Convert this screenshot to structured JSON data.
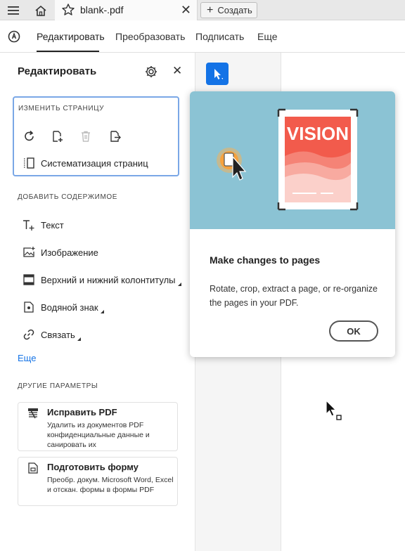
{
  "tabbar": {
    "tab_title": "blank-.pdf",
    "create_label": "Создать"
  },
  "topnav": {
    "items": [
      "Редактировать",
      "Преобразовать",
      "Подписать",
      "Еще"
    ]
  },
  "panel": {
    "title": "Редактировать",
    "edit_section": {
      "label": "ИЗМЕНИТЬ СТРАНИЦУ",
      "organize_label": "Систематизация страниц"
    },
    "add_section": {
      "label": "ДОБАВИТЬ СОДЕРЖИМОЕ",
      "items": [
        "Текст",
        "Изображение",
        "Верхний и нижний колонтитулы",
        "Водяной знак",
        "Связать"
      ]
    },
    "more_link": "Еще",
    "other_section": {
      "label": "ДРУГИЕ ПАРАМЕТРЫ",
      "cards": [
        {
          "title": "Исправить PDF",
          "desc": "Удалить из документов PDF конфиденциальные данные и санировать их"
        },
        {
          "title": "Подготовить форму",
          "desc": "Преобр. докум. Microsoft Word, Excel и отскан. формы в формы PDF"
        }
      ]
    }
  },
  "popover": {
    "image_text": "VISION",
    "title": "Make changes to pages",
    "description": "Rotate, crop, extract a page, or re-organize the pages in your PDF.",
    "ok_label": "OK"
  },
  "colors": {
    "accent": "#1473e6",
    "popover_bg": "#8bc3d4",
    "focus_border": "#7aa7e6"
  }
}
